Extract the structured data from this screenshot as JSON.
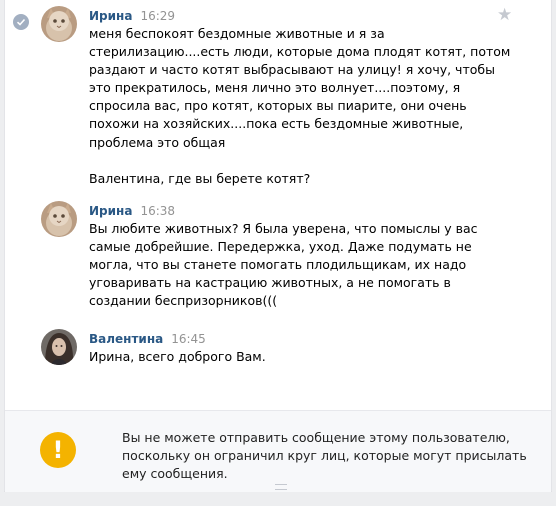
{
  "messages": [
    {
      "author": "Ирина",
      "time": "16:29",
      "avatar": "cat-avatar",
      "lines": [
        "меня беспокоят бездомные животные и я за",
        "стерилизацию....есть люди, которые дома плодят котят, потом",
        "раздают и часто котят выбрасывают на улицу! я хочу, чтобы",
        "это прекратилось, меня лично это волнует....поэтому, я",
        "спросила вас, про котят, которых вы пиарите, они очень",
        "похожи на хозяйских....пока есть бездомные животные,",
        "проблема это общая"
      ],
      "extra_line": "Валентина, где вы берете котят?"
    },
    {
      "author": "Ирина",
      "time": "16:38",
      "avatar": "cat-avatar",
      "lines": [
        "Вы любите животных? Я была уверена, что помыслы у вас",
        "самые добрейшие. Передержка, уход. Даже подумать не",
        "могла, что вы станете помогать плодильщикам, их надо",
        "уговаривать на кастрацию животных, а не помогать в",
        "создании беспризорников((("
      ]
    },
    {
      "author": "Валентина",
      "time": "16:45",
      "avatar": "woman-avatar",
      "lines": [
        "Ирина, всего доброго Вам."
      ]
    }
  ],
  "notice": {
    "icon": "warning-icon",
    "symbol": "!",
    "lines": [
      "Вы не можете отправить сообщение этому пользователю,",
      "поскольку он ограничил круг лиц, которые могут присылать",
      "ему сообщения."
    ]
  },
  "colors": {
    "author": "#2a5885",
    "time": "#939393",
    "warning": "#f4b300",
    "read_check": "#a2afc1",
    "star": "#c5c9d0"
  },
  "icons": {
    "read": "check-circle-icon",
    "favorite": "star-icon",
    "resize": "grip-icon"
  }
}
